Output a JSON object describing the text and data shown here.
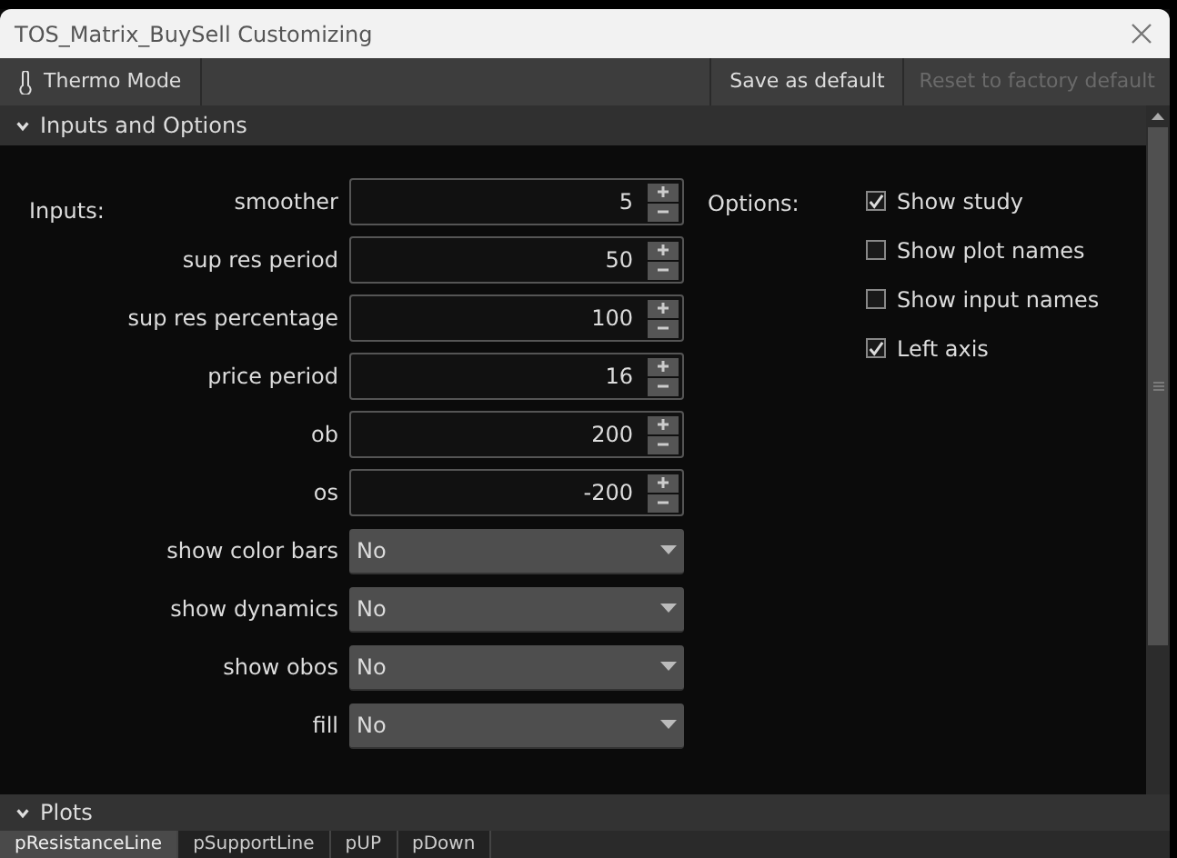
{
  "window": {
    "title": "TOS_Matrix_BuySell Customizing"
  },
  "toolbar": {
    "mode_button": "Thermo Mode",
    "save_button": "Save as default",
    "reset_button": {
      "label": "Reset to factory default",
      "disabled": true
    }
  },
  "inputs_section": {
    "title": "Inputs and Options",
    "expanded": true,
    "inputs_label": "Inputs:",
    "options_label": "Options:",
    "inputs": [
      {
        "kind": "number",
        "label": "smoother",
        "value": "5"
      },
      {
        "kind": "number",
        "label": "sup res period",
        "value": "50"
      },
      {
        "kind": "number",
        "label": "sup res percentage",
        "value": "100"
      },
      {
        "kind": "number",
        "label": "price period",
        "value": "16"
      },
      {
        "kind": "number",
        "label": "ob",
        "value": "200"
      },
      {
        "kind": "number",
        "label": "os",
        "value": "-200"
      },
      {
        "kind": "select",
        "label": "show color bars",
        "value": "No"
      },
      {
        "kind": "select",
        "label": "show dynamics",
        "value": "No"
      },
      {
        "kind": "select",
        "label": "show obos",
        "value": "No"
      },
      {
        "kind": "select",
        "label": "fill",
        "value": "No"
      }
    ],
    "options": [
      {
        "label": "Show study",
        "checked": true
      },
      {
        "label": "Show plot names",
        "checked": false
      },
      {
        "label": "Show input names",
        "checked": false
      },
      {
        "label": "Left axis",
        "checked": true
      }
    ]
  },
  "plots_section": {
    "title": "Plots",
    "expanded": true,
    "tabs": [
      {
        "label": "pResistanceLine",
        "selected": true
      },
      {
        "label": "pSupportLine",
        "selected": false
      },
      {
        "label": "pUP",
        "selected": false
      },
      {
        "label": "pDown",
        "selected": false
      }
    ]
  }
}
